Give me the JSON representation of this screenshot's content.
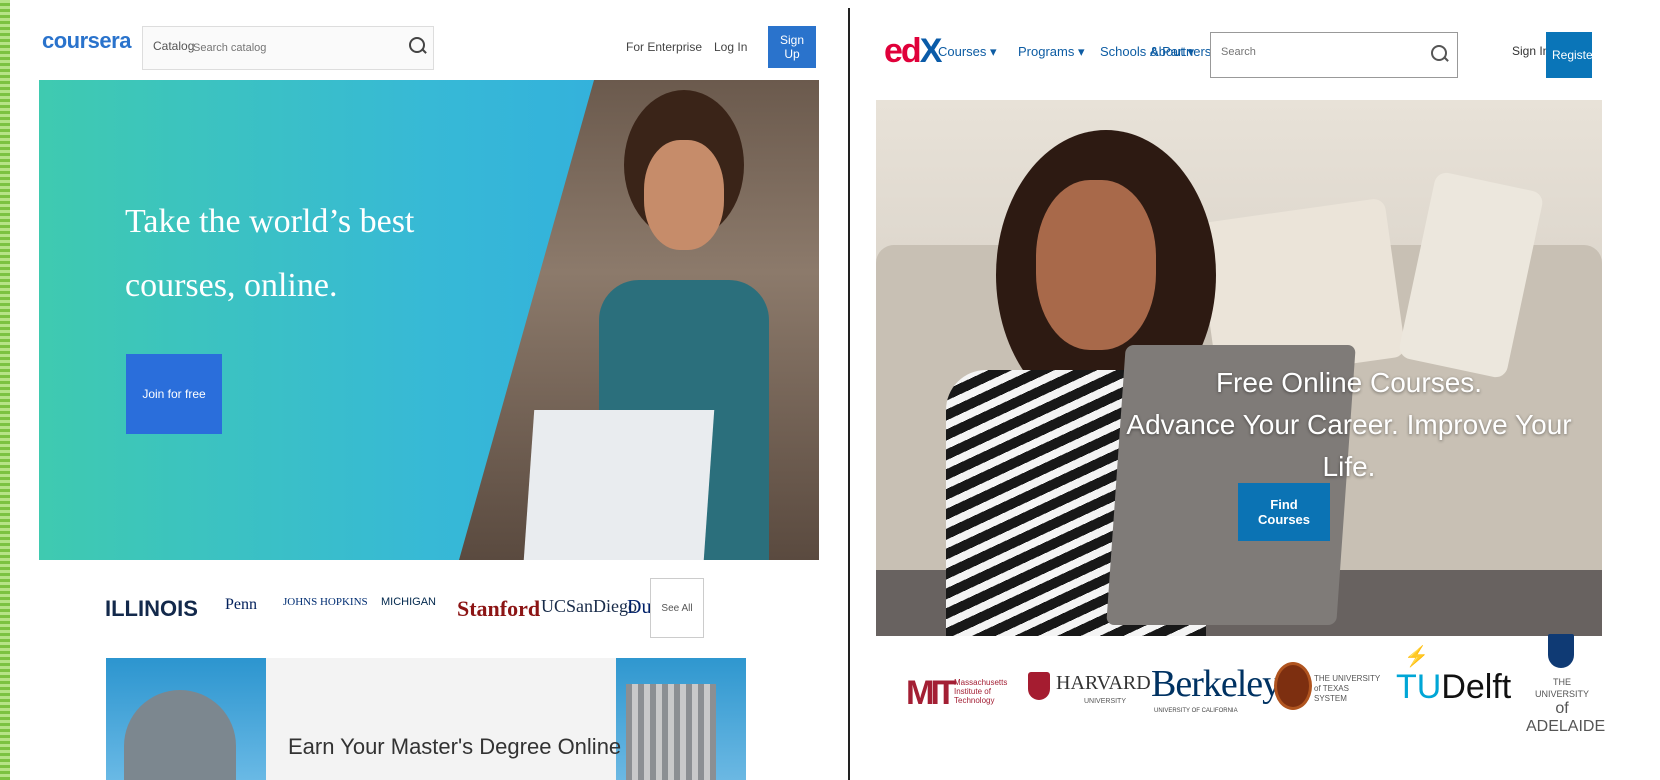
{
  "coursera": {
    "logo": "coursera",
    "catalog_label": "Catalog",
    "search_placeholder": "Search catalog",
    "for_enterprise": "For Enterprise",
    "login": "Log In",
    "signup": "Sign Up",
    "hero_title": "Take the world’s best courses, online.",
    "join_button": "Join for free",
    "universities": [
      "ILLINOIS",
      "Penn",
      "JOHNS HOPKINS",
      "MICHIGAN",
      "Stanford",
      "UCSanDiego",
      "Duke"
    ],
    "see_all": "See All",
    "banner_text": "Earn Your Master's Degree Online"
  },
  "edx": {
    "logo_e": "ed",
    "logo_x": "X",
    "nav": [
      "Courses ▾",
      "Programs ▾",
      "Schools & Partners",
      "About ▾"
    ],
    "search_placeholder": "Search",
    "sign_in": "Sign In",
    "register": "Register",
    "hero_line1": "Free Online Courses.",
    "hero_line2": "Advance Your Career. Improve Your Life.",
    "find_courses": "Find Courses",
    "partners": {
      "mit": "MIT",
      "mit_sub": "Massachusetts Institute of Technology",
      "harvard": "HARVARD",
      "harvard_sub": "UNIVERSITY",
      "berkeley": "Berkeley",
      "berkeley_sub": "UNIVERSITY OF CALIFORNIA",
      "texas": "THE UNIVERSITY of TEXAS SYSTEM",
      "tudelft_t": "TU",
      "tudelft_rest": "Delft",
      "adelaide_small": "THE UNIVERSITY",
      "adelaide_main": "of ADELAIDE"
    }
  },
  "colors": {
    "background": "#8fd14f",
    "coursera_blue": "#2a73cc",
    "edx_blue": "#0b73b4"
  }
}
